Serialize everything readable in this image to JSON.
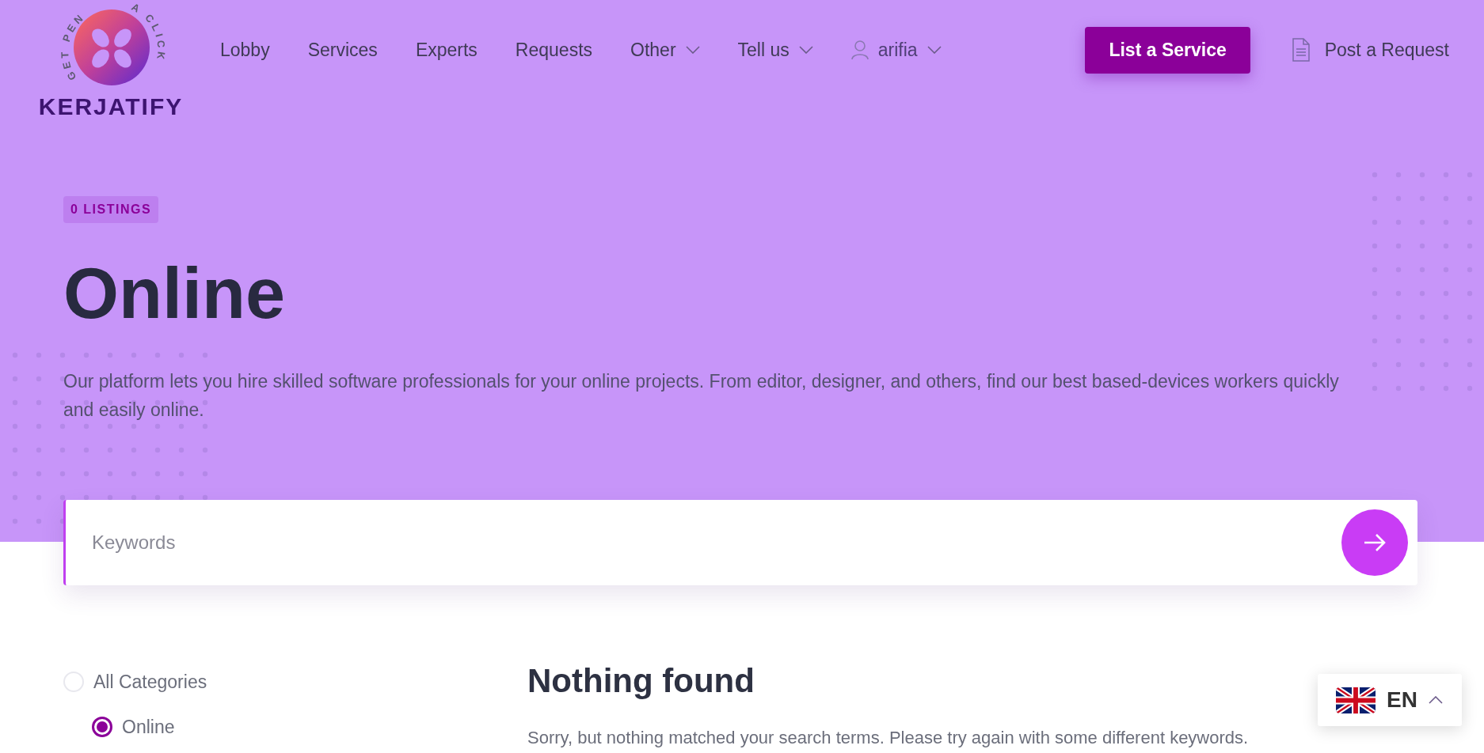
{
  "logo": {
    "tagline_left": "GET PEN",
    "tagline_right": "A CLICK",
    "name": "KERJATIFY"
  },
  "nav": {
    "items": [
      {
        "label": "Lobby",
        "dropdown": false
      },
      {
        "label": "Services",
        "dropdown": false
      },
      {
        "label": "Experts",
        "dropdown": false
      },
      {
        "label": "Requests",
        "dropdown": false
      },
      {
        "label": "Other",
        "dropdown": true
      },
      {
        "label": "Tell us",
        "dropdown": true
      }
    ],
    "user": {
      "name": "arifia"
    },
    "cta": "List a Service",
    "post": "Post a Request"
  },
  "hero": {
    "badge": "0 LISTINGS",
    "title": "Online",
    "description": "Our platform lets you hire skilled software professionals for your online projects. From editor, designer, and others, find our best based-devices workers quickly and easily online."
  },
  "search": {
    "placeholder": "Keywords"
  },
  "categories": [
    {
      "label": "All Categories",
      "selected": false,
      "children": [
        {
          "label": "Online",
          "selected": true
        }
      ]
    }
  ],
  "results": {
    "title": "Nothing found",
    "message": "Sorry, but nothing matched your search terms. Please try again with some different keywords."
  },
  "language": {
    "code": "EN",
    "expanded": true
  }
}
